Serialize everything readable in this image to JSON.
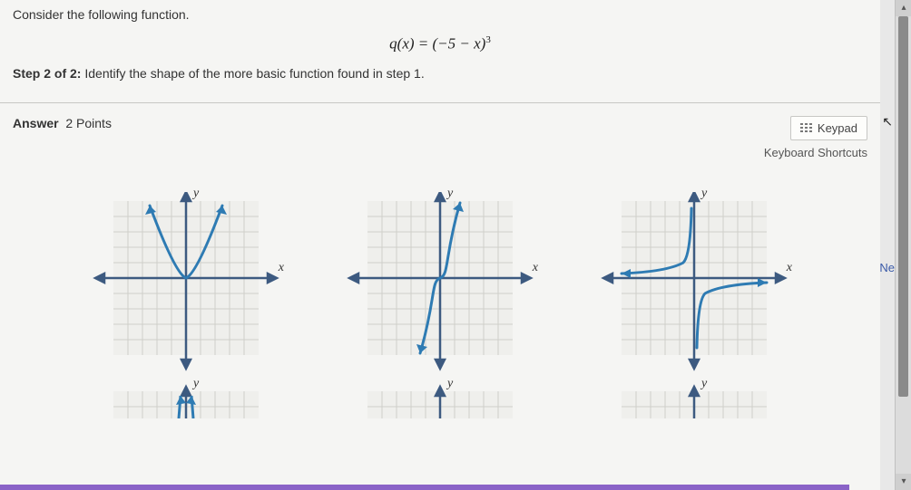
{
  "question": {
    "prompt": "Consider the following function.",
    "formula_html": "q(x) = (−5 − x)",
    "exponent": "3",
    "step_label": "Step 2 of 2:",
    "step_text": " Identify the shape of the more basic function found in step 1."
  },
  "answer_bar": {
    "label_bold": "Answer",
    "points": "2 Points",
    "keypad": "Keypad",
    "shortcuts": "Keyboard Shortcuts"
  },
  "axis": {
    "x": "x",
    "y": "y"
  },
  "side": {
    "next": "Ne"
  },
  "chart_data": [
    {
      "type": "line",
      "title": "",
      "xlabel": "x",
      "ylabel": "y",
      "xlim": [
        -5,
        5
      ],
      "ylim": [
        -5,
        5
      ],
      "description": "Upward opening V/parabola-like shape touching origin",
      "series": [
        {
          "name": "left-branch",
          "x": [
            -3,
            -2,
            -1,
            0
          ],
          "y": [
            4.5,
            2.5,
            1,
            0
          ]
        },
        {
          "name": "right-branch",
          "x": [
            0,
            1,
            2,
            3
          ],
          "y": [
            0,
            1,
            2.5,
            4.5
          ]
        }
      ]
    },
    {
      "type": "line",
      "title": "",
      "xlabel": "x",
      "ylabel": "y",
      "xlim": [
        -5,
        5
      ],
      "ylim": [
        -5,
        5
      ],
      "description": "Cubic curve y = x^3 through origin",
      "series": [
        {
          "name": "cubic",
          "x": [
            -1.7,
            -1.3,
            -1,
            -0.5,
            0,
            0.5,
            1,
            1.3,
            1.7
          ],
          "y": [
            -4.9,
            -2.2,
            -1,
            -0.13,
            0,
            0.13,
            1,
            2.2,
            4.9
          ]
        }
      ]
    },
    {
      "type": "line",
      "title": "",
      "xlabel": "x",
      "ylabel": "y",
      "xlim": [
        -5,
        5
      ],
      "ylim": [
        -5,
        5
      ],
      "description": "Reciprocal-like hyperbola, asymptotes at axes, branches in QII and QIV",
      "series": [
        {
          "name": "upper-left",
          "x": [
            -5,
            -3,
            -2,
            -1,
            -0.5,
            -0.3
          ],
          "y": [
            0.2,
            0.33,
            0.5,
            1,
            2,
            3.3
          ]
        },
        {
          "name": "lower-right",
          "x": [
            0.3,
            0.5,
            1,
            2,
            3,
            5
          ],
          "y": [
            -3.3,
            -2,
            -1,
            -0.5,
            -0.33,
            -0.2
          ]
        }
      ]
    }
  ]
}
